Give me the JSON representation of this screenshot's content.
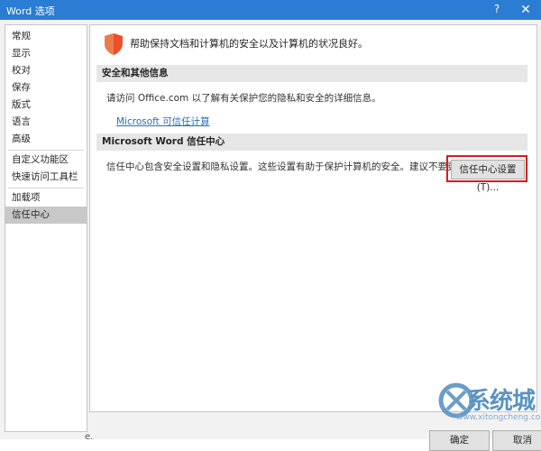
{
  "window": {
    "title": "Word 选项",
    "help_label": "?",
    "close_label": "✕"
  },
  "sidebar": {
    "items": [
      {
        "label": "常规"
      },
      {
        "label": "显示"
      },
      {
        "label": "校对"
      },
      {
        "label": "保存"
      },
      {
        "label": "版式"
      },
      {
        "label": "语言"
      },
      {
        "label": "高级"
      },
      {
        "label": "自定义功能区"
      },
      {
        "label": "快速访问工具栏"
      },
      {
        "label": "加载项"
      },
      {
        "label": "信任中心",
        "selected": true
      }
    ]
  },
  "main": {
    "headline": "帮助保持文档和计算机的安全以及计算机的状况良好。",
    "security_section": {
      "heading": "安全和其他信息",
      "text": "请访问 Office.com 以了解有关保护您的隐私和安全的详细信息。",
      "link": "Microsoft 可信任计算"
    },
    "trust_section": {
      "heading": "Microsoft Word 信任中心",
      "text": "信任中心包含安全设置和隐私设置。这些设置有助于保护计算机的安全。建议不要更改这些设置。",
      "button_label": "信任中心设置(T)..."
    }
  },
  "footer": {
    "stray_text": "e.",
    "ok_label": "确定",
    "cancel_label": "取消"
  },
  "watermark": {
    "text": "系统城",
    "url": "www.xitongcheng.com"
  },
  "colors": {
    "titlebar": "#2b7cd3",
    "highlight": "#e0161c",
    "shield": "#e8512a",
    "link": "#2a6fb5"
  }
}
